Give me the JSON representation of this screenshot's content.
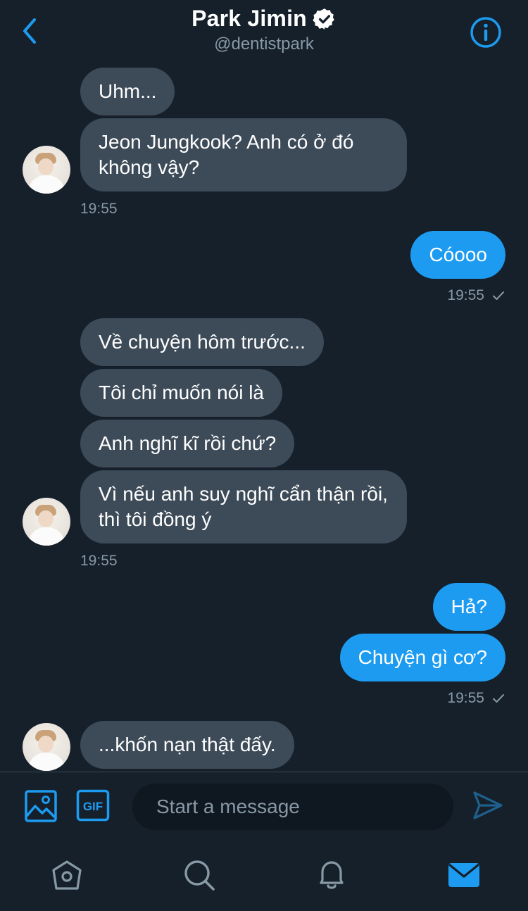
{
  "header": {
    "title": "Park Jimin",
    "handle": "@dentistpark",
    "back_icon": "chevron-left-icon",
    "verified_icon": "verified-badge-icon",
    "info_icon": "info-icon"
  },
  "messages": {
    "g1_m1": "Uhm...",
    "g1_m2": "Jeon Jungkook? Anh có ở đó không vậy?",
    "g1_time": "19:55",
    "s1_m1": "Cóooo",
    "s1_time": "19:55",
    "g2_m1": "Về chuyện hôm trước...",
    "g2_m2": "Tôi chỉ muốn nói là",
    "g2_m3": "Anh nghĩ kĩ rồi chứ?",
    "g2_m4": "Vì nếu anh suy nghĩ cẩn thận rồi, thì tôi đồng ý",
    "g2_time": "19:55",
    "s2_m1": "Hả?",
    "s2_m2": "Chuyện gì cơ?",
    "s2_time": "19:55",
    "g3_m1": "...khốn nạn thật đấy."
  },
  "composer": {
    "placeholder": "Start a message",
    "image_icon": "image-icon",
    "gif_label": "GIF",
    "send_icon": "send-icon"
  },
  "nav": {
    "home_icon": "home-icon",
    "search_icon": "search-icon",
    "notifications_icon": "bell-icon",
    "messages_icon": "mail-icon"
  },
  "colors": {
    "background": "#15202b",
    "received_bubble": "#3d4b59",
    "sent_bubble": "#1d9bf0",
    "accent": "#1d9bf0",
    "muted_text": "#8899a6"
  }
}
